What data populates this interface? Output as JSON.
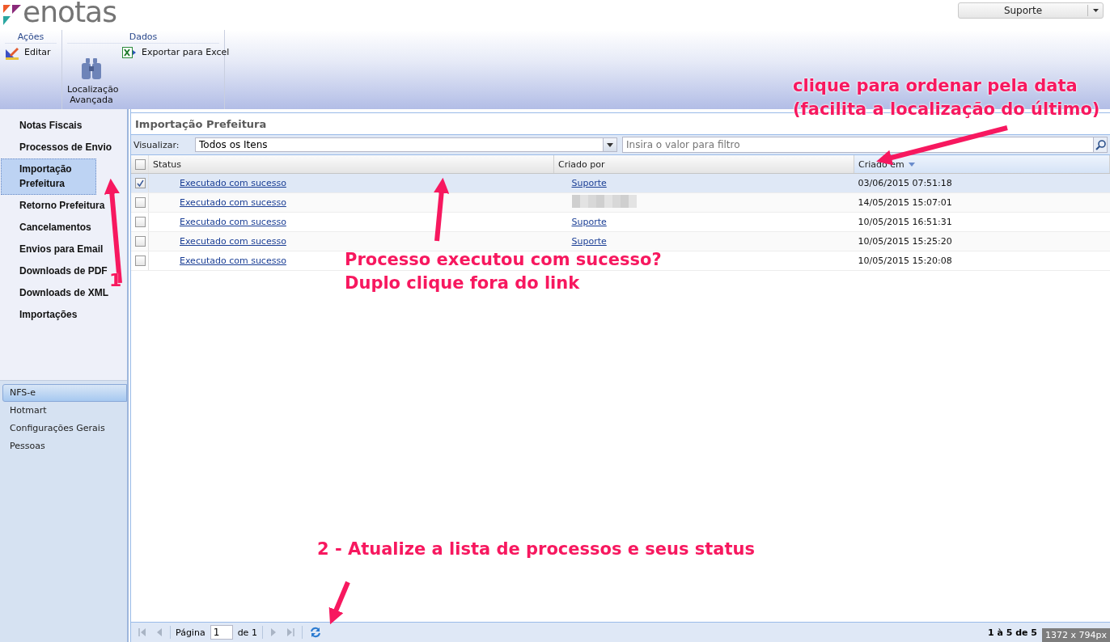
{
  "header": {
    "logo": "enotas",
    "user_menu": "Suporte",
    "ribbon_groups": [
      {
        "title": "Ações",
        "items": [
          {
            "kind": "small",
            "label": "Editar"
          }
        ]
      },
      {
        "title": "Dados",
        "items": [
          {
            "kind": "large",
            "label": "Localização Avançada"
          },
          {
            "kind": "small",
            "label": "Exportar para Excel"
          }
        ]
      }
    ]
  },
  "sidebar": {
    "nav_items": [
      {
        "label": "Notas Fiscais",
        "selected": false
      },
      {
        "label": "Processos de Envio",
        "selected": false
      },
      {
        "label": "Importação Prefeitura",
        "selected": true
      },
      {
        "label": "Retorno Prefeitura",
        "selected": false
      },
      {
        "label": "Cancelamentos",
        "selected": false
      },
      {
        "label": "Envios para Email",
        "selected": false
      },
      {
        "label": "Downloads de PDF",
        "selected": false
      },
      {
        "label": "Downloads de XML",
        "selected": false
      },
      {
        "label": "Importações",
        "selected": false
      }
    ],
    "sections": [
      {
        "label": "NFS-e",
        "selected": true
      },
      {
        "label": "Hotmart",
        "selected": false
      },
      {
        "label": "Configurações Gerais",
        "selected": false
      },
      {
        "label": "Pessoas",
        "selected": false
      }
    ]
  },
  "main": {
    "title": "Importação Prefeitura",
    "view_label": "Visualizar:",
    "view_select": "Todos os Itens",
    "filter": {
      "placeholder": "Insira o valor para filtro"
    },
    "table": {
      "all_checked": false,
      "columns": [
        {
          "label": "Status",
          "sorted": false
        },
        {
          "label": "Criado por",
          "sorted": false
        },
        {
          "label": "Criado em",
          "sorted": true
        }
      ],
      "rows": [
        {
          "checked": true,
          "selected": true,
          "status": "Executado com sucesso",
          "created_by": "Suporte",
          "created_by_redacted": false,
          "created_at": "03/06/2015 07:51:18"
        },
        {
          "checked": false,
          "selected": false,
          "status": "Executado com sucesso",
          "created_by_redacted": true,
          "created_at": "14/05/2015 15:07:01"
        },
        {
          "checked": false,
          "selected": false,
          "status": "Executado com sucesso",
          "created_by": "Suporte",
          "created_by_redacted": false,
          "created_at": "10/05/2015 16:51:31"
        },
        {
          "checked": false,
          "selected": false,
          "status": "Executado com sucesso",
          "created_by": "Suporte",
          "created_by_redacted": false,
          "created_at": "10/05/2015 15:25:20"
        },
        {
          "checked": false,
          "selected": false,
          "status": "Executado com sucesso",
          "created_by_redacted": false,
          "created_at": "10/05/2015 15:20:08"
        }
      ]
    },
    "pager": {
      "page_label": "Página",
      "page_value": "1",
      "page_total": "de 1",
      "summary": "1 à 5 de 5"
    }
  },
  "annotations": [
    {
      "kind": "note",
      "lines": [
        "clique para ordenar pela data",
        "(facilita a localização do último)"
      ]
    },
    {
      "kind": "note",
      "lines": [
        "Processo executou com sucesso?",
        "Duplo clique fora do link"
      ]
    },
    {
      "kind": "note",
      "lines": [
        "2 - Atualize a lista de processos e seus status"
      ]
    },
    {
      "kind": "marker",
      "lines": [
        "1"
      ]
    }
  ],
  "size_badge": "1372 x 794px"
}
